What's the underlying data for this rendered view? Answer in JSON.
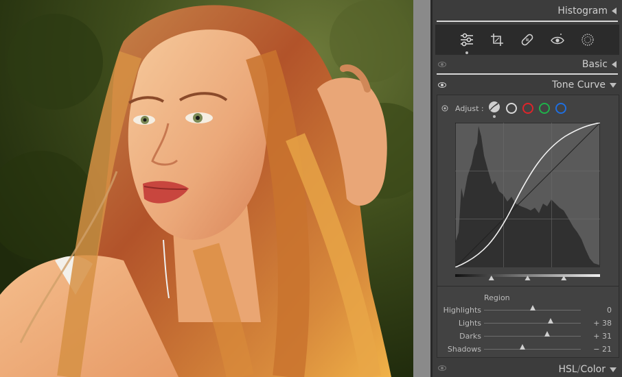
{
  "panels": {
    "histogram": {
      "title": "Histogram"
    },
    "basic": {
      "title": "Basic"
    },
    "tone_curve": {
      "title": "Tone Curve",
      "adjust_label": "Adjust :",
      "channels": [
        {
          "name": "parametric",
          "color": "#d0d0d0"
        },
        {
          "name": "luminance",
          "color": "#d8d8d8"
        },
        {
          "name": "red",
          "color": "#e0242a"
        },
        {
          "name": "green",
          "color": "#1fb34a"
        },
        {
          "name": "blue",
          "color": "#1f6fe0"
        }
      ],
      "region": {
        "title": "Region",
        "sliders": [
          {
            "label": "Highlights",
            "value": 0,
            "display": "0"
          },
          {
            "label": "Lights",
            "value": 38,
            "display": "+ 38"
          },
          {
            "label": "Darks",
            "value": 31,
            "display": "+ 31"
          },
          {
            "label": "Shadows",
            "value": -21,
            "display": "− 21"
          }
        ]
      },
      "split_points": [
        0.25,
        0.5,
        0.75
      ]
    },
    "hsl_color": {
      "title_a": "HSL",
      "separator": "/",
      "title_b": "Color"
    }
  },
  "toolbar": {
    "tools": [
      {
        "name": "edit-sliders-icon",
        "active": true
      },
      {
        "name": "crop-icon",
        "active": false
      },
      {
        "name": "healing-icon",
        "active": false
      },
      {
        "name": "red-eye-icon",
        "active": false
      },
      {
        "name": "masking-icon",
        "active": false
      }
    ]
  },
  "colors": {
    "accent_panel": "#3c3c3c",
    "curve_line": "#f2f2f2",
    "histogram_fill": "#2e2e2e",
    "curve_bg": "#5a5a5a"
  }
}
